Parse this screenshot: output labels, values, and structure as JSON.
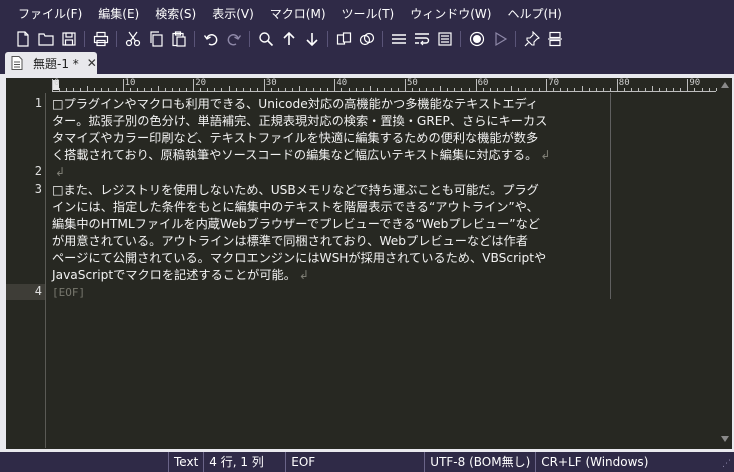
{
  "menu": [
    "ファイル(F)",
    "編集(E)",
    "検索(S)",
    "表示(V)",
    "マクロ(M)",
    "ツール(T)",
    "ウィンドウ(W)",
    "ヘルプ(H)"
  ],
  "toolbar": {
    "icons": [
      "new-file-icon",
      "open-folder-icon",
      "save-icon",
      "print-icon",
      "cut-icon",
      "copy-icon",
      "paste-icon",
      "undo-icon",
      "redo-icon",
      "search-icon",
      "find-previous-icon",
      "find-next-icon",
      "compare-icon",
      "compare-next-icon",
      "no-wrap-icon",
      "word-wrap-icon",
      "window-wrap-icon",
      "record-macro-icon",
      "run-macro-icon",
      "pin-icon",
      "split-icon"
    ]
  },
  "tab": {
    "label": "無題-1 *",
    "close": "✕"
  },
  "ruler": {
    "labels": [
      "0",
      "10",
      "20",
      "30",
      "40",
      "50",
      "60",
      "70",
      "80",
      "90"
    ]
  },
  "lines": [
    {
      "number": "1",
      "rows": [
        "□プラグインやマクロも利用できる、Unicode対応の高機能かつ多機能なテキストエディ",
        "ター。拡張子別の色分け、単語補完、正規表現対応の検索・置換・GREP、さらにキーカス",
        "タマイズやカラー印刷など、テキストファイルを快適に編集するための便利な機能が数多",
        "く搭載されており、原稿執筆やソースコードの編集など幅広いテキスト編集に対応する。"
      ]
    },
    {
      "number": "2",
      "rows": [
        ""
      ]
    },
    {
      "number": "3",
      "rows": [
        "□また、レジストリを使用しないため、USBメモリなどで持ち運ぶことも可能だ。プラグ",
        "インには、指定した条件をもとに編集中のテキストを階層表示できる“アウトライン”や、",
        "編集中のHTMLファイルを内蔵Webブラウザーでプレビューできる“Webプレビュー”など",
        "が用意されている。アウトラインは標準で同梱されており、Webプレビューなどは作者",
        "ページにて公開されている。マクロエンジンにはWSHが採用されているため、VBScriptや",
        "JavaScriptでマクロを記述することが可能。"
      ]
    },
    {
      "number": "4",
      "rows": [
        "[EOF]"
      ]
    }
  ],
  "newline_mark": "↲",
  "status": {
    "mode": "Text",
    "position": "4 行, 1 列",
    "eof": "EOF",
    "encoding": "UTF-8 (BOM無し)",
    "newline": "CR+LF (Windows)"
  },
  "colors": {
    "chrome": "#2f2a47",
    "editor_bg": "#272822",
    "text": "#f2f2f2",
    "tab_bg": "#e8e8ec"
  }
}
